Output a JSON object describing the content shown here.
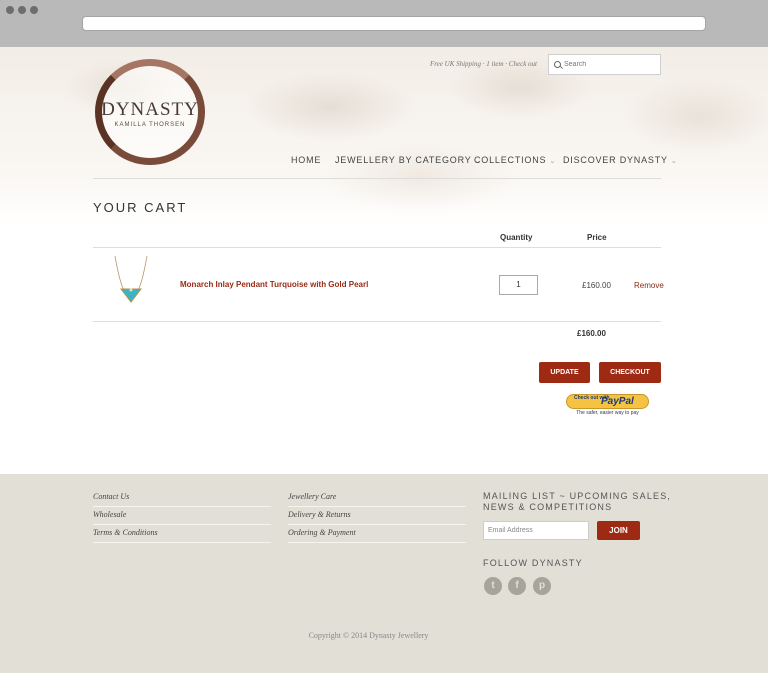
{
  "header": {
    "logo_title": "DYNASTY",
    "logo_subtitle": "KAMILLA THORSEN",
    "topline": "Free UK Shipping · 1 item · Check out",
    "search_placeholder": "Search"
  },
  "nav": [
    {
      "label": "HOME",
      "has_dropdown": false
    },
    {
      "label": "JEWELLERY BY CATEGORY",
      "has_dropdown": true
    },
    {
      "label": "COLLECTIONS",
      "has_dropdown": true
    },
    {
      "label": "DISCOVER DYNASTY",
      "has_dropdown": true
    }
  ],
  "cart": {
    "title": "YOUR CART",
    "columns": {
      "quantity": "Quantity",
      "price": "Price"
    },
    "items": [
      {
        "name": "Monarch Inlay Pendant Turquoise with Gold Pearl",
        "quantity": "1",
        "price": "£160.00",
        "remove_label": "Remove"
      }
    ],
    "total": "£160.00",
    "update_label": "UPDATE",
    "checkout_label": "CHECKOUT",
    "paypal": {
      "small_text": "Check out with",
      "brand": "PayPal",
      "tagline": "The safer, easier way to pay"
    }
  },
  "footer": {
    "col1": [
      "Contact Us",
      "Wholesale",
      "Terms & Conditions"
    ],
    "col2": [
      "Jewellery Care",
      "Delivery & Returns",
      "Ordering & Payment"
    ],
    "mailing_heading": "MAILING LIST ~ UPCOMING SALES, NEWS & COMPETITIONS",
    "email_placeholder": "Email Address",
    "join_label": "JOIN",
    "follow_heading": "FOLLOW DYNASTY",
    "social_icons": [
      "twitter-icon",
      "facebook-icon",
      "pinterest-icon"
    ],
    "copyright": "Copyright © 2014 Dynasty Jewellery"
  },
  "colors": {
    "accent": "#9e2a14",
    "footer_bg": "#e2dfd7"
  }
}
